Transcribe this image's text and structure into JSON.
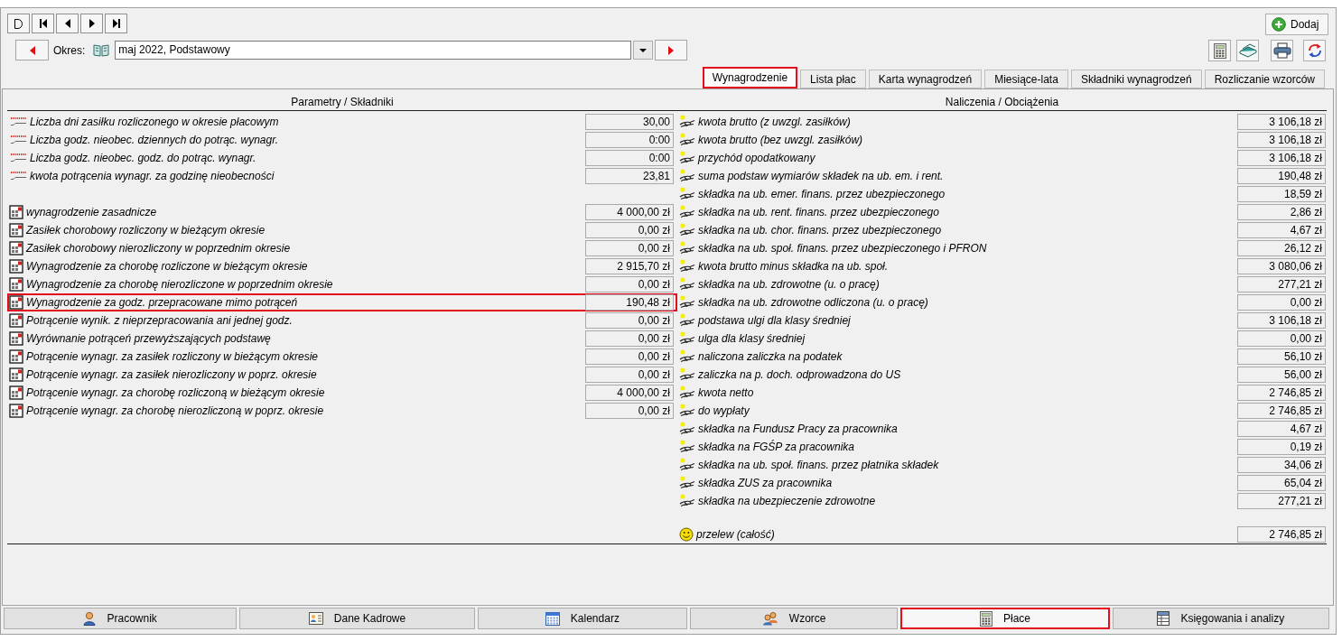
{
  "period": {
    "label": "Okres:",
    "value": "maj 2022, Podstawowy"
  },
  "add_button": "Dodaj",
  "tabs": [
    {
      "label": "Wynagrodzenie",
      "selected": true,
      "highlighted": true
    },
    {
      "label": "Lista płac",
      "selected": false,
      "highlighted": false
    },
    {
      "label": "Karta wynagrodzeń",
      "selected": false,
      "highlighted": false
    },
    {
      "label": "Miesiące-lata",
      "selected": false,
      "highlighted": false
    },
    {
      "label": "Składniki wynagrodzeń",
      "selected": false,
      "highlighted": false
    },
    {
      "label": "Rozliczanie wzorców",
      "selected": false,
      "highlighted": false
    }
  ],
  "headings": {
    "left": "Parametry / Składniki",
    "right": "Naliczenia / Obciążenia"
  },
  "parameters": [
    {
      "label": "Liczba dni zasiłku rozliczonego w okresie płacowym",
      "value": "30,00"
    },
    {
      "label": "Liczba godz. nieobec. dziennych do potrąc. wynagr.",
      "value": "0:00"
    },
    {
      "label": "Liczba godz. nieobec. godz. do potrąc. wynagr.",
      "value": "0:00"
    },
    {
      "label": "kwota potrącenia wynagr. za godzinę nieobecności",
      "value": "23,81"
    }
  ],
  "components": [
    {
      "label": "wynagrodzenie zasadnicze",
      "value": "4 000,00 zł",
      "highlighted": false
    },
    {
      "label": "Zasiłek chorobowy rozliczony w bieżącym okresie",
      "value": "0,00 zł",
      "highlighted": false
    },
    {
      "label": "Zasiłek chorobowy nierozliczony w poprzednim okresie",
      "value": "0,00 zł",
      "highlighted": false
    },
    {
      "label": "Wynagrodzenie za chorobę rozliczone w bieżącym okresie",
      "value": "2 915,70 zł",
      "highlighted": false
    },
    {
      "label": "Wynagrodzenie za chorobę nierozliczone w poprzednim okresie",
      "value": "0,00 zł",
      "highlighted": false
    },
    {
      "label": "Wynagrodzenie za godz. przepracowane mimo potrąceń",
      "value": "190,48 zł",
      "highlighted": true
    },
    {
      "label": "Potrącenie wynik. z nieprzepracowania ani jednej godz.",
      "value": "0,00 zł",
      "highlighted": false
    },
    {
      "label": "Wyrównanie potrąceń przewyższających podstawę",
      "value": "0,00 zł",
      "highlighted": false
    },
    {
      "label": "Potrącenie wynagr. za zasiłek rozliczony w bieżącym okresie",
      "value": "0,00 zł",
      "highlighted": false
    },
    {
      "label": "Potrącenie wynagr. za zasiłek nierozliczony w poprz. okresie",
      "value": "0,00 zł",
      "highlighted": false
    },
    {
      "label": "Potrącenie wynagr. za chorobę rozliczoną w bieżącym okresie",
      "value": "4 000,00 zł",
      "highlighted": false
    },
    {
      "label": "Potrącenie wynagr. za chorobę nierozliczoną w poprz. okresie",
      "value": "0,00 zł",
      "highlighted": false
    }
  ],
  "charges": [
    {
      "label": "kwota brutto (z uwzgl. zasiłków)",
      "value": "3 106,18 zł"
    },
    {
      "label": "kwota brutto (bez uwzgl. zasiłków)",
      "value": "3 106,18 zł"
    },
    {
      "label": "przychód opodatkowany",
      "value": "3 106,18 zł"
    },
    {
      "label": "suma podstaw wymiarów składek na ub. em. i rent.",
      "value": "190,48 zł"
    },
    {
      "label": "składka na ub. emer. finans. przez ubezpieczonego",
      "value": "18,59 zł"
    },
    {
      "label": "składka na ub. rent. finans. przez ubezpieczonego",
      "value": "2,86 zł"
    },
    {
      "label": "składka na ub. chor. finans. przez ubezpieczonego",
      "value": "4,67 zł"
    },
    {
      "label": "składka na ub. społ. finans. przez ubezpieczonego i PFRON",
      "value": "26,12 zł"
    },
    {
      "label": "kwota brutto minus składka na ub. społ.",
      "value": "3 080,06 zł"
    },
    {
      "label": "składka na ub. zdrowotne (u. o pracę)",
      "value": "277,21 zł"
    },
    {
      "label": "składka na ub. zdrowotne odliczona (u. o pracę)",
      "value": "0,00 zł"
    },
    {
      "label": "podstawa ulgi dla klasy średniej",
      "value": "3 106,18 zł"
    },
    {
      "label": "ulga dla klasy średniej",
      "value": "0,00 zł"
    },
    {
      "label": "naliczona zaliczka na podatek",
      "value": "56,10 zł"
    },
    {
      "label": "zaliczka na p. doch. odprowadzona do US",
      "value": "56,00 zł"
    },
    {
      "label": "kwota netto",
      "value": "2 746,85 zł"
    },
    {
      "label": "do wypłaty",
      "value": "2 746,85 zł"
    },
    {
      "label": "składka na Fundusz Pracy za pracownika",
      "value": "4,67 zł"
    },
    {
      "label": "składka na FGŚP za pracownika",
      "value": "0,19 zł"
    },
    {
      "label": "składka na ub. społ. finans. przez płatnika składek",
      "value": "34,06 zł"
    },
    {
      "label": "składka ZUS za pracownika",
      "value": "65,04 zł"
    },
    {
      "label": "składka na ubezpieczenie zdrowotne",
      "value": "277,21 zł"
    }
  ],
  "transfer": {
    "label": "przelew (całość)",
    "value": "2 746,85 zł"
  },
  "bottom_nav": [
    {
      "label": "Pracownik",
      "selected": false,
      "highlighted": false
    },
    {
      "label": "Dane Kadrowe",
      "selected": false,
      "highlighted": false
    },
    {
      "label": "Kalendarz",
      "selected": false,
      "highlighted": false
    },
    {
      "label": "Wzorce",
      "selected": false,
      "highlighted": false
    },
    {
      "label": "Płace",
      "selected": true,
      "highlighted": true
    },
    {
      "label": "Księgowania i analizy",
      "selected": false,
      "highlighted": false
    }
  ]
}
